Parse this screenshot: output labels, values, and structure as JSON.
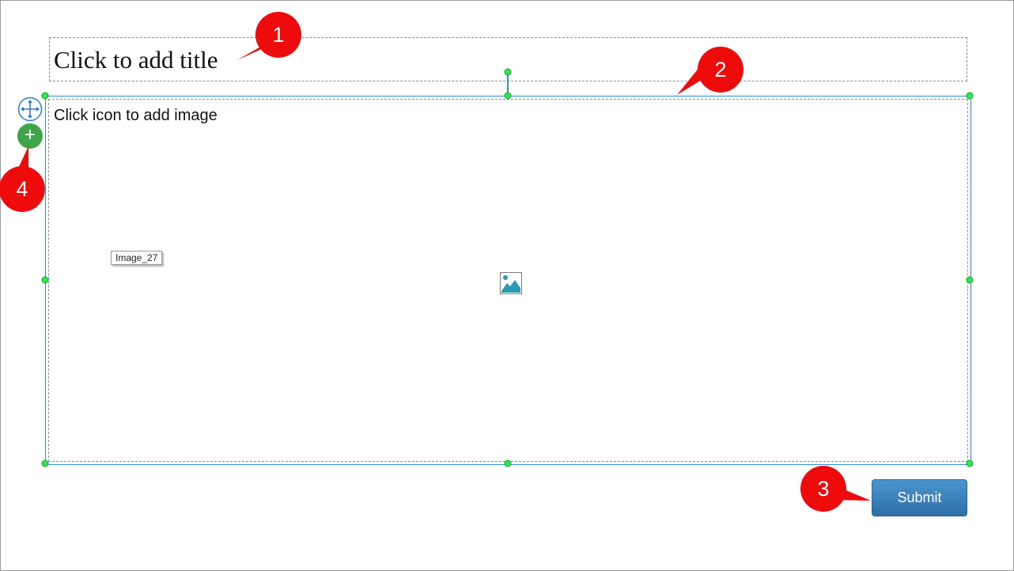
{
  "editor": {
    "title_placeholder": "Click to add title",
    "image_hint": "Click icon to add image",
    "image_tag": "Image_27",
    "submit_label": "Submit"
  },
  "toolbar": {
    "move_icon": "move-arrows-icon",
    "add_icon": "plus-icon",
    "add_label": "+"
  },
  "callouts": [
    "1",
    "2",
    "3",
    "4"
  ],
  "colors": {
    "selection": "#2d8fd6",
    "handle": "#2ee84e",
    "add_button": "#3da548",
    "submit": "#3a82bd",
    "callout": "#ee0b0b"
  }
}
